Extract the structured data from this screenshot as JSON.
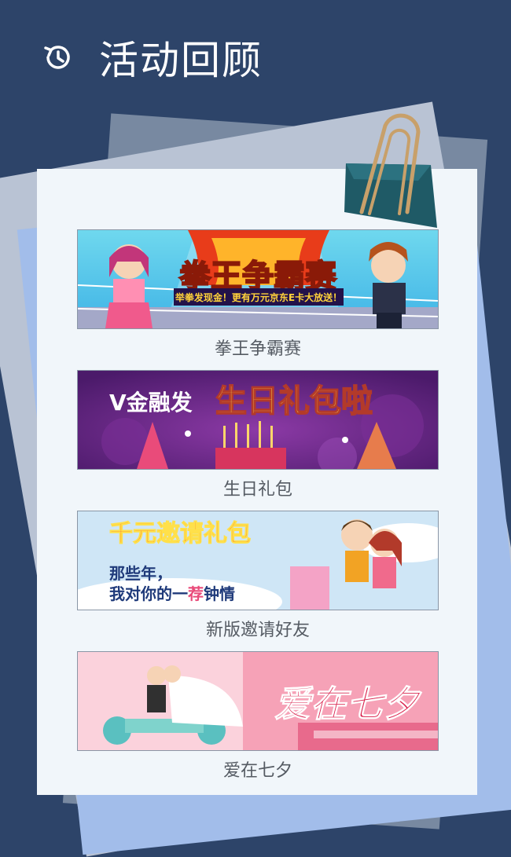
{
  "header": {
    "title": "活动回顾",
    "icon": "history-icon"
  },
  "activities": [
    {
      "caption": "拳王争霸赛",
      "banner_title": "拳王争霸赛",
      "banner_subtitle": "举拳发现金！更有万元京东E卡大放送！"
    },
    {
      "caption": "生日礼包",
      "banner_title_prefix": "V金融发",
      "banner_title": "生日礼包啦"
    },
    {
      "caption": "新版邀请好友",
      "banner_title": "千元邀请礼包",
      "banner_line1": "那些年，",
      "banner_line2_a": "我对你的一",
      "banner_line2_b": "荐",
      "banner_line2_c": "钟情"
    },
    {
      "caption": "爱在七夕",
      "banner_title": "爱在七夕"
    }
  ],
  "colors": {
    "background": "#2d4469",
    "paper": "#f1f6fa",
    "caption": "#555b63"
  }
}
